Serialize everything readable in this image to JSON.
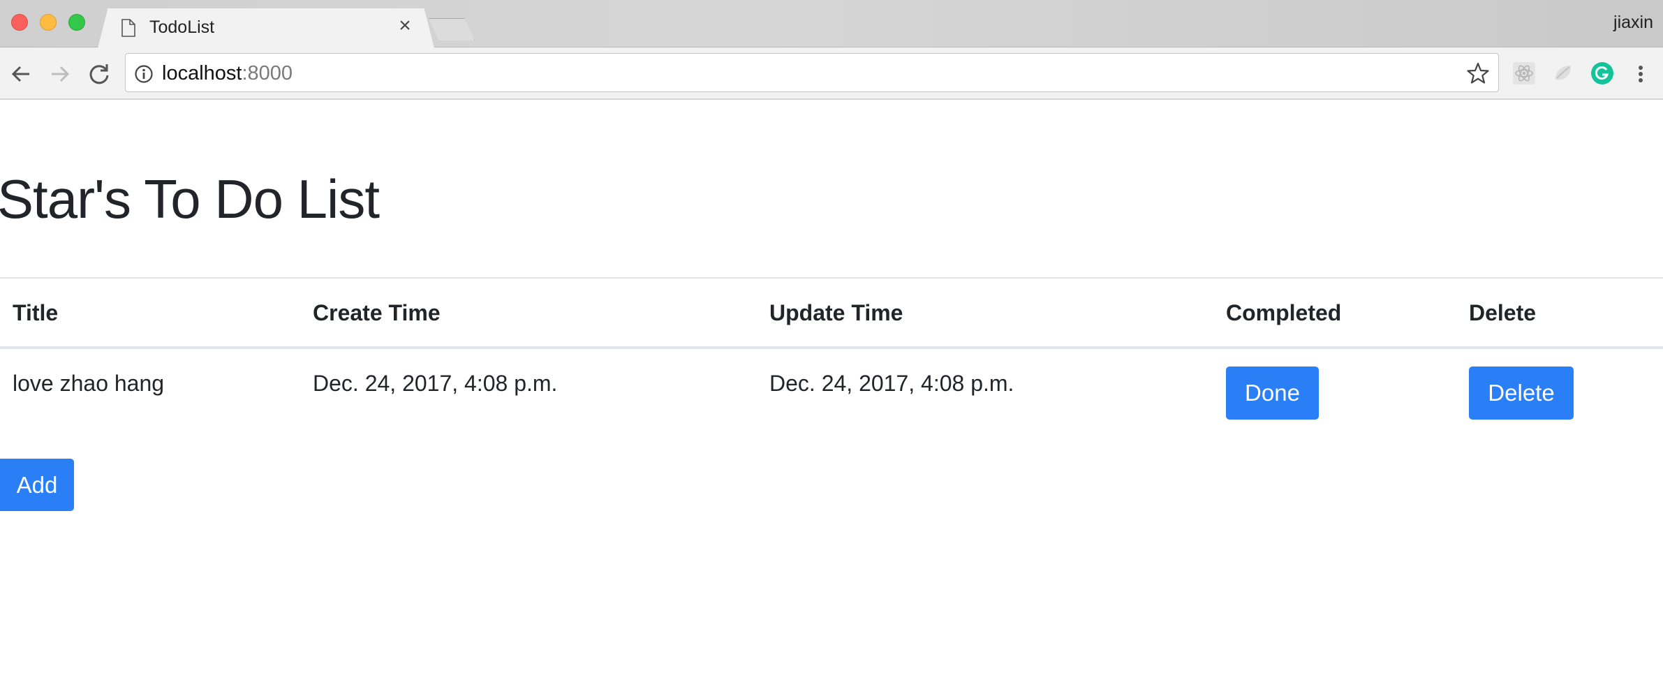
{
  "browser": {
    "tab_title": "TodoList",
    "tab_close": "×",
    "user": "jiaxin",
    "url_host": "localhost",
    "url_port": ":8000"
  },
  "page": {
    "title": "Star's To Do List",
    "table": {
      "headers": [
        "Title",
        "Create Time",
        "Update Time",
        "Completed",
        "Delete"
      ],
      "rows": [
        {
          "title": "love zhao hang",
          "create_time": "Dec. 24, 2017, 4:08 p.m.",
          "update_time": "Dec. 24, 2017, 4:08 p.m.",
          "done_label": "Done",
          "delete_label": "Delete"
        }
      ]
    },
    "add_label": "Add"
  },
  "colors": {
    "primary": "#2a7ff6",
    "text": "#212529",
    "grammarly": "#15c39a"
  }
}
